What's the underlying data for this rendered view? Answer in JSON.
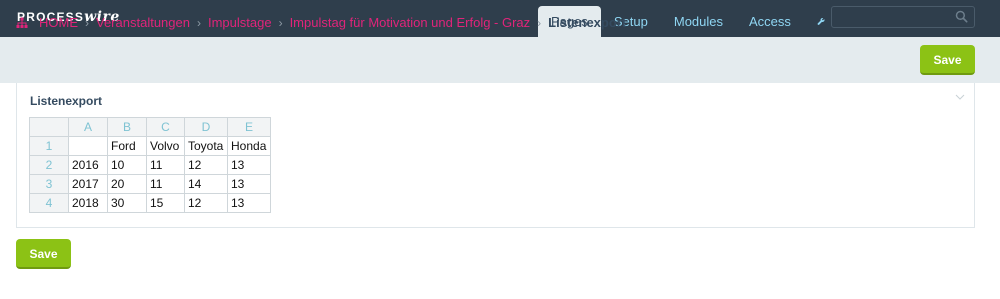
{
  "app": {
    "logo_part1": "PROCESS",
    "logo_part2": "wire"
  },
  "topnav": {
    "items": [
      {
        "label": "Pages",
        "active": true
      },
      {
        "label": "Setup"
      },
      {
        "label": "Modules"
      },
      {
        "label": "Access"
      }
    ],
    "search": {
      "placeholder": "",
      "value": "",
      "icon": "search-icon"
    },
    "tools_icon": "wrench-icon"
  },
  "breadcrumb": {
    "home_icon": "sitemap-icon",
    "items": [
      "HOME",
      "Veranstaltungen",
      "Impulstage",
      "Impulstag für Motivation und Erfolg - Graz"
    ],
    "current": "Listenexport"
  },
  "actions": {
    "save_top": "Save",
    "save_bottom": "Save"
  },
  "panel": {
    "title": "Listenexport",
    "toggle_icon": "chevron-down-icon",
    "sheet": {
      "col_headers": [
        "A",
        "B",
        "C",
        "D",
        "E"
      ],
      "rows": [
        {
          "n": "1",
          "cells": [
            "",
            "Ford",
            "Volvo",
            "Toyota",
            "Honda"
          ]
        },
        {
          "n": "2",
          "cells": [
            "2016",
            "10",
            "11",
            "12",
            "13"
          ]
        },
        {
          "n": "3",
          "cells": [
            "2017",
            "20",
            "11",
            "14",
            "13"
          ]
        },
        {
          "n": "4",
          "cells": [
            "2018",
            "30",
            "15",
            "12",
            "13"
          ]
        }
      ]
    }
  },
  "colors": {
    "masthead": "#2f3e4c",
    "link": "#e0247a",
    "button": "#8cc215",
    "nav_text": "#8fd6f3"
  }
}
